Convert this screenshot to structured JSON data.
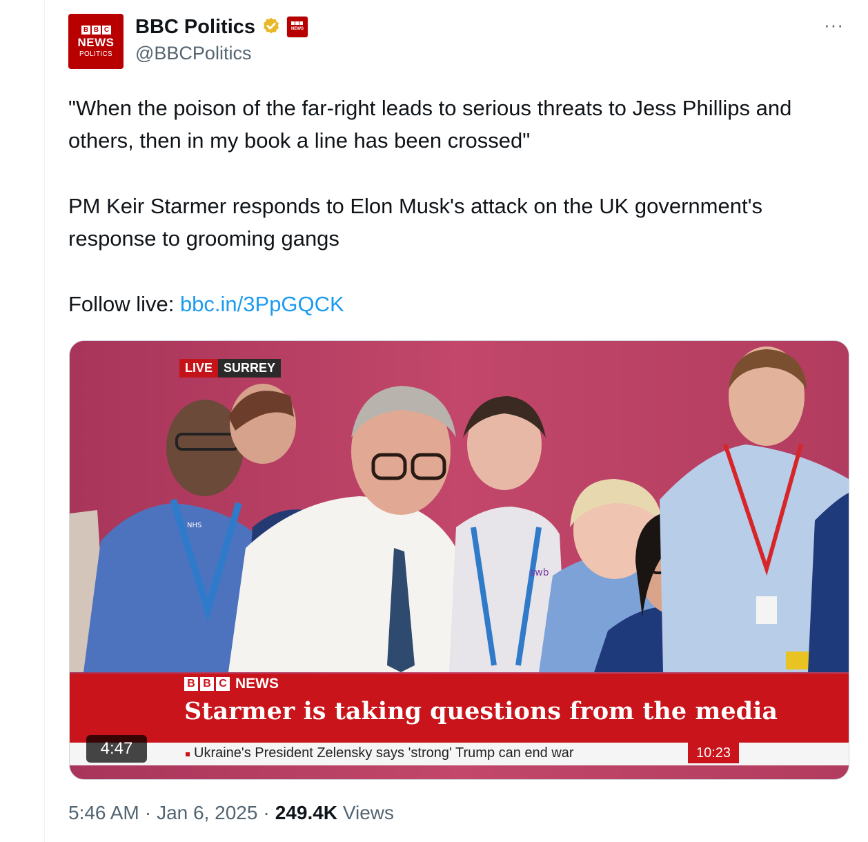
{
  "account": {
    "display_name": "BBC Politics",
    "handle": "@BBCPolitics",
    "avatar_blocks": [
      "B",
      "B",
      "C"
    ],
    "avatar_line1": "NEWS",
    "avatar_line2": "POLITICS",
    "verified_icon": "verified-gold-badge-icon",
    "affiliate_badge_label": "NEWS",
    "more_label": "···"
  },
  "tweet": {
    "quote": "\"When the poison of the far-right leads to serious threats to Jess Phillips and others, then in my book a line has been crossed\"",
    "body": "PM Keir Starmer responds to Elon Musk's attack on the UK government's response to grooming gangs",
    "follow_prefix": "Follow live: ",
    "link_text": "bbc.in/3PpGQCK"
  },
  "media": {
    "live_label": "LIVE",
    "location_label": "SURREY",
    "logo_blocks": [
      "B",
      "B",
      "C"
    ],
    "logo_text": "NEWS",
    "headline": "Starmer is taking questions from the media",
    "ticker": "Ukraine's President Zelensky says 'strong' Trump can end war",
    "clock": "10:23",
    "duration": "4:47",
    "lanyard_text": "NHS",
    "badge_text": "swb"
  },
  "meta": {
    "time": "5:46 AM",
    "sep1": "·",
    "date": "Jan 6, 2025",
    "sep2": "·",
    "views_count": "249.4K",
    "views_label": "Views"
  },
  "colors": {
    "bbc_red": "#b80000",
    "link_blue": "#1d9bf0",
    "secondary_text": "#536471",
    "backdrop_pink": "#b5405e"
  }
}
